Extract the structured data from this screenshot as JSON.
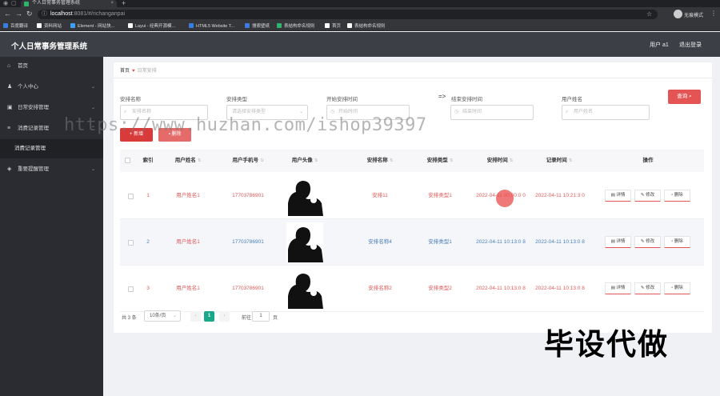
{
  "browser": {
    "tab_title": "个人日常事务管理系统",
    "url_host": "localhost",
    "url_path": ":8081/#/richanganpai",
    "incognito_label": "无痕模式",
    "bookmarks": [
      {
        "label": "百度翻译",
        "color": "#3b7ddd"
      },
      {
        "label": "资料网站",
        "color": "#ffffff"
      },
      {
        "label": "Element - 网站快...",
        "color": "#409eff"
      },
      {
        "label": "Layui - 经典开源模...",
        "color": "#ffffff"
      },
      {
        "label": "HTML5 Website T...",
        "color": "#3b7ddd"
      },
      {
        "label": "搜索壁纸",
        "color": "#3b7ddd"
      },
      {
        "label": "表结构命名规则",
        "color": "#2fb56b"
      },
      {
        "label": "首页",
        "color": "#ffffff"
      },
      {
        "label": "表结构命名规则",
        "color": "#ffffff"
      }
    ]
  },
  "header": {
    "title": "个人日常事务管理系统",
    "user": "用户 a1",
    "logout": "退出登录"
  },
  "sidebar": {
    "items": [
      {
        "label": "首页",
        "icon": "home-icon"
      },
      {
        "label": "个人中心",
        "icon": "user-icon"
      },
      {
        "label": "日常安排管理",
        "icon": "calendar-icon"
      },
      {
        "label": "消费记录管理",
        "icon": "list-icon"
      },
      {
        "label": "重要提醒管理",
        "icon": "bell-icon"
      }
    ],
    "sub_item": "消费记录管理"
  },
  "breadcrumb": {
    "home": "首页",
    "current": "日常安排"
  },
  "filters": {
    "name_label": "安排名称",
    "name_placeholder": "安排名称",
    "type_label": "安排类型",
    "type_placeholder": "请选择安排类型",
    "start_label": "开始安排时间",
    "start_placeholder": "开始时间",
    "arrow": "=>",
    "end_label": "结束安排时间",
    "end_placeholder": "结束时间",
    "user_label": "用户姓名",
    "user_placeholder": "用户姓名",
    "search_button": "查询"
  },
  "actions": {
    "add": "+ 新增",
    "delete": "删除"
  },
  "table": {
    "headers": [
      "索引",
      "用户姓名",
      "用户手机号",
      "用户头像",
      "安排名称",
      "安排类型",
      "安排时间",
      "记录时间",
      "操作"
    ],
    "rows": [
      {
        "index": "1",
        "name": "用户姓名1",
        "phone": "17703786901",
        "plan": "安排11",
        "type": "安排类型1",
        "plan_time": "2022-04-11 00:00:0 0",
        "record_time": "2022-04-11 10:21:3 0",
        "color": "red"
      },
      {
        "index": "2",
        "name": "用户姓名1",
        "phone": "17703786901",
        "plan": "安排名称4",
        "type": "安排类型1",
        "plan_time": "2022-04-11 10:13:0 8",
        "record_time": "2022-04-11 10:13:0 8",
        "color": "blue"
      },
      {
        "index": "3",
        "name": "用户姓名1",
        "phone": "17703786901",
        "plan": "安排名称2",
        "type": "安排类型2",
        "plan_time": "2022-04-11 10:13:0 8",
        "record_time": "2022-04-11 10:13:0 8",
        "color": "red"
      }
    ],
    "row_actions": {
      "detail": "详情",
      "edit": "修改",
      "remove": "删除"
    }
  },
  "pagination": {
    "total": "共 3 条",
    "page_size": "10条/页",
    "current": "1",
    "goto_label": "前往",
    "goto_value": "1",
    "page_unit": "页"
  },
  "watermark": "https://www.huzhan.com/ishop39397",
  "overlay": "毕设代做"
}
